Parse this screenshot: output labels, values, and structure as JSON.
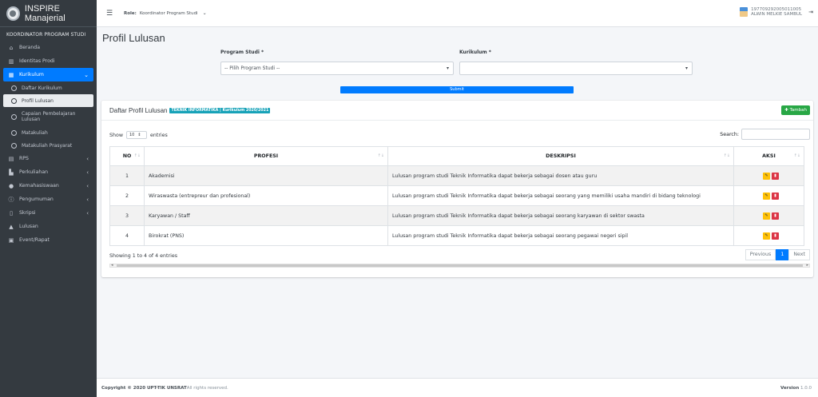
{
  "brand": {
    "name": "INSPIRE Manajerial"
  },
  "sidebar": {
    "role_header": "KOORDINATOR PROGRAM STUDI",
    "items": [
      {
        "label": "Beranda",
        "icon": "home-icon"
      },
      {
        "label": "Identitas Prodi",
        "icon": "institution-icon"
      },
      {
        "label": "Kurikulum",
        "icon": "table-icon"
      },
      {
        "label": "RPS",
        "icon": "clipboard-icon"
      },
      {
        "label": "Perkuliahan",
        "icon": "teacher-icon"
      },
      {
        "label": "Kemahasiswaan",
        "icon": "users-icon"
      },
      {
        "label": "Pengumuman",
        "icon": "info-icon"
      },
      {
        "label": "Skripsi",
        "icon": "file-icon"
      },
      {
        "label": "Lulusan",
        "icon": "graduation-cap-icon"
      },
      {
        "label": "Event/Rapat",
        "icon": "calendar-icon"
      }
    ],
    "sub_items": [
      {
        "label": "Daftar Kurikulum"
      },
      {
        "label": "Profil Lulusan"
      },
      {
        "label": "Capaian Pembelajaran Lulusan"
      },
      {
        "label": "Matakuliah"
      },
      {
        "label": "Matakuliah Prasyarat"
      }
    ]
  },
  "topbar": {
    "role_label": "Role:",
    "role_value": "Koordinator Program Studi",
    "user_id": "197709292005011005",
    "user_name": "ALWIN MELKIE SAMBUL"
  },
  "page": {
    "title": "Profil Lulusan",
    "program_label": "Program Studi *",
    "program_placeholder": "-- Pilih Program Studi --",
    "kurikulum_label": "Kurikulum *",
    "kurikulum_value": "",
    "submit_label": "Submit"
  },
  "card": {
    "title": "Daftar Profil Lulusan",
    "badge": "TEKNIK INFORMATIKA | Kurikulum 2020/2021",
    "add_label": "Tambah"
  },
  "datatable": {
    "show_label": "Show",
    "length_value": "10",
    "entries_label": "entries",
    "search_label": "Search:",
    "columns": [
      "NO",
      "PROFESI",
      "DESKRIPSI",
      "AKSI"
    ],
    "rows": [
      {
        "no": "1",
        "profesi": "Akademisi",
        "deskripsi": "Lulusan program studi Teknik Informatika dapat bekerja sebagai dosen atau guru"
      },
      {
        "no": "2",
        "profesi": "Wiraswasta (entrepreur dan profesional)",
        "deskripsi": "Lulusan program studi Teknik Informatika dapat bekerja sebagai seorang yang memiliki usaha mandiri di bidang teknologi"
      },
      {
        "no": "3",
        "profesi": "Karyawan / Staff",
        "deskripsi": "Lulusan program studi Teknik Informatika dapat bekerja sebagai seorang karyawan di sektor swasta"
      },
      {
        "no": "4",
        "profesi": "Birokrat (PNS)",
        "deskripsi": "Lulusan program studi Teknik Informatika dapat bekerja sebagai seorang pegawai negeri sipil"
      }
    ],
    "info": "Showing 1 to 4 of 4 entries",
    "prev_label": "Previous",
    "current_page": "1",
    "next_label": "Next"
  },
  "footer": {
    "copyright": "Copyright © 2020 UPT-TIK UNSRAT",
    "rights": " All rights reserved.",
    "version_label": "Version",
    "version": "1.0.0"
  },
  "colors": {
    "primary": "#007bff",
    "sidebar": "#343a40",
    "success": "#28a745",
    "info": "#17a2b8",
    "warning": "#ffc107",
    "danger": "#dc3545"
  }
}
